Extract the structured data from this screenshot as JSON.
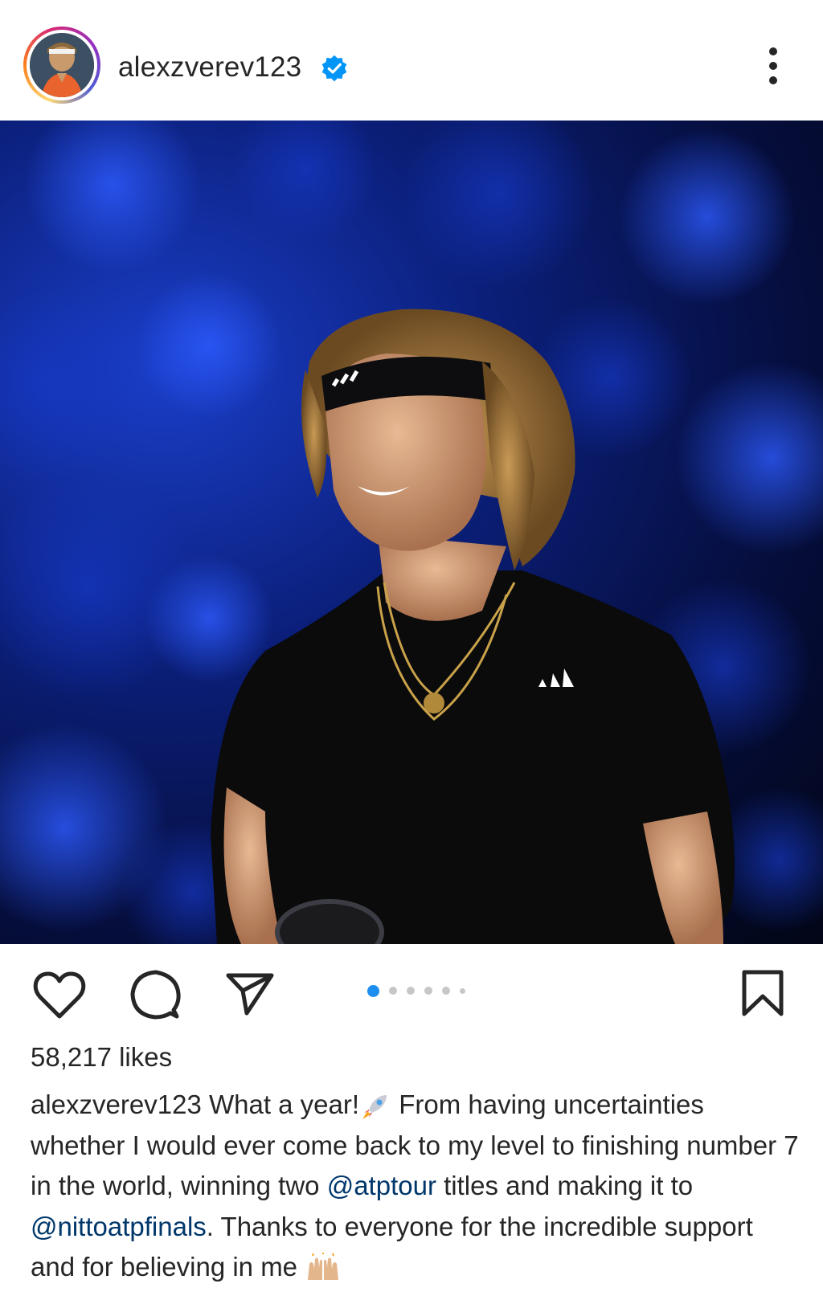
{
  "post": {
    "username": "alexzverev123",
    "verified": true,
    "likes": "58,217 likes",
    "carousel": {
      "total": 6,
      "active_index": 0
    },
    "caption": {
      "username": "alexzverev123",
      "text_1": " What a year!",
      "emoji_1": "rocket",
      "text_2": " From having uncertainties whether I would ever come back to my level to finishing number 7 in the world, winning two ",
      "mention_1": "@atptour",
      "text_3": " titles and making it to ",
      "mention_2": "@nittoatpfinals",
      "text_4": ". Thanks to everyone for the incredible support and for believing in me ",
      "emoji_2": "raising-hands"
    }
  },
  "icons": {
    "like": "heart-icon",
    "comment": "comment-icon",
    "share": "send-icon",
    "save": "bookmark-icon",
    "more": "more-vertical-icon",
    "verified": "verified-badge-icon"
  },
  "colors": {
    "text": "#262626",
    "mention": "#00376b",
    "verified": "#0095f6",
    "carousel_active": "#1d8ef0",
    "carousel_inactive": "#c7c7c7"
  }
}
